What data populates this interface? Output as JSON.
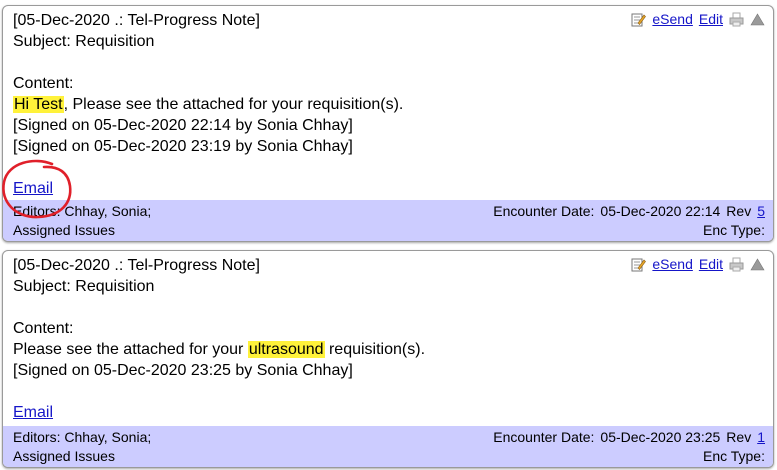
{
  "notes": [
    {
      "header": "[05-Dec-2020 .: Tel-Progress Note]",
      "subject": "Subject: Requisition",
      "content_label": "Content:",
      "content_line": {
        "pre": "",
        "highlight": "Hi Test",
        "post": ", Please see the attached for your requisition(s)."
      },
      "signatures": [
        "[Signed on 05-Dec-2020 22:14 by Sonia Chhay]",
        "[Signed on 05-Dec-2020 23:19 by Sonia Chhay]"
      ],
      "email_link": "Email",
      "actions": {
        "esend": "eSend",
        "edit": "Edit"
      },
      "footer": {
        "editors": "Editors: Chhay, Sonia;",
        "assigned": "Assigned Issues",
        "encounter_label": "Encounter Date:",
        "encounter_date": "05-Dec-2020 22:14",
        "rev_label": "Rev",
        "rev_value": "5",
        "enc_type": "Enc Type:"
      }
    },
    {
      "header": "[05-Dec-2020 .: Tel-Progress Note]",
      "subject": "Subject: Requisition",
      "content_label": "Content:",
      "content_line": {
        "pre": "Please see the attached for your ",
        "highlight": "ultrasound",
        "post": " requisition(s)."
      },
      "signatures": [
        "[Signed on 05-Dec-2020 23:25 by Sonia Chhay]"
      ],
      "email_link": "Email",
      "actions": {
        "esend": "eSend",
        "edit": "Edit"
      },
      "footer": {
        "editors": "Editors: Chhay, Sonia;",
        "assigned": "Assigned Issues",
        "encounter_label": "Encounter Date:",
        "encounter_date": "05-Dec-2020 23:25",
        "rev_label": "Rev",
        "rev_value": "1",
        "enc_type": "Enc Type:"
      }
    }
  ],
  "icons": [
    "note-edit-icon",
    "print-icon",
    "collapse-triangle-icon"
  ],
  "colors": {
    "footer_bg": "#ccccff",
    "link": "#1515c8",
    "highlight": "#fff23a",
    "annotation_circle": "#e0202a"
  }
}
